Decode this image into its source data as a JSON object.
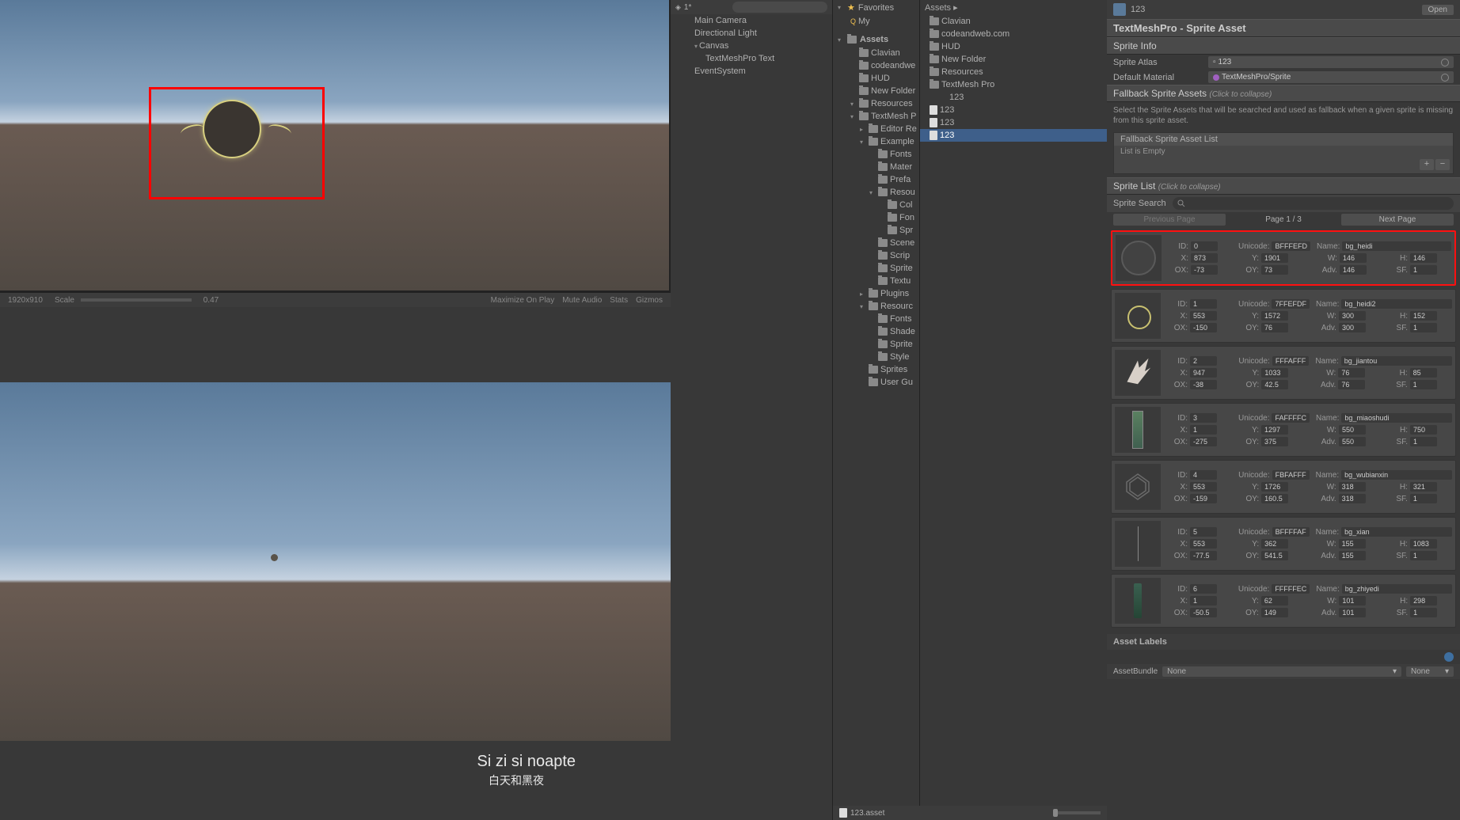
{
  "hierarchy": {
    "scene_name": "1*",
    "items": [
      {
        "label": "Main Camera",
        "l": 1
      },
      {
        "label": "Directional Light",
        "l": 1
      },
      {
        "label": "Canvas",
        "l": 1,
        "fold": "open"
      },
      {
        "label": "TextMeshPro Text",
        "l": 2
      },
      {
        "label": "EventSystem",
        "l": 1
      }
    ]
  },
  "game_controls": {
    "resolution": "1920x910",
    "scale_label": "Scale",
    "scale_value": "0.47",
    "right": [
      "Maximize On Play",
      "Mute Audio",
      "Stats",
      "Gizmos"
    ]
  },
  "subtitles": {
    "line1": "Si zi si noapte",
    "line2": "白天和黑夜"
  },
  "project": {
    "favorites_label": "Favorites",
    "my_label": "My",
    "assets_label": "Assets",
    "tree": [
      {
        "label": "Clavian",
        "l": 1
      },
      {
        "label": "codeandwe",
        "l": 1,
        "cut": true
      },
      {
        "label": "HUD",
        "l": 1
      },
      {
        "label": "New Folder",
        "l": 1,
        "cut": true
      },
      {
        "label": "Resources",
        "l": 1,
        "fold": "open"
      },
      {
        "label": "TextMesh P",
        "l": 1,
        "fold": "open",
        "cut": true
      },
      {
        "label": "Editor Re",
        "l": 2,
        "fold": "closed",
        "cut": true
      },
      {
        "label": "Example",
        "l": 2,
        "fold": "open",
        "cut": true
      },
      {
        "label": "Fonts",
        "l": 3
      },
      {
        "label": "Mater",
        "l": 3,
        "cut": true
      },
      {
        "label": "Prefa",
        "l": 3,
        "cut": true
      },
      {
        "label": "Resou",
        "l": 3,
        "fold": "open",
        "cut": true
      },
      {
        "label": "Col",
        "l": 4,
        "cut": true
      },
      {
        "label": "Fon",
        "l": 4,
        "cut": true
      },
      {
        "label": "Spr",
        "l": 4,
        "cut": true
      },
      {
        "label": "Scene",
        "l": 3,
        "cut": true
      },
      {
        "label": "Scrip",
        "l": 3,
        "cut": true
      },
      {
        "label": "Sprite",
        "l": 3,
        "cut": true
      },
      {
        "label": "Textu",
        "l": 3,
        "cut": true
      },
      {
        "label": "Plugins",
        "l": 2,
        "fold": "closed"
      },
      {
        "label": "Resourc",
        "l": 2,
        "fold": "open",
        "cut": true
      },
      {
        "label": "Fonts",
        "l": 3
      },
      {
        "label": "Shade",
        "l": 3,
        "cut": true
      },
      {
        "label": "Sprite",
        "l": 3,
        "cut": true
      },
      {
        "label": "Style",
        "l": 3,
        "cut": true
      },
      {
        "label": "Sprites",
        "l": 2
      },
      {
        "label": "User Gu",
        "l": 2,
        "cut": true
      }
    ],
    "breadcrumb": "Assets ▸",
    "right_items": [
      {
        "label": "Clavian",
        "icon": "folder"
      },
      {
        "label": "codeandweb.com",
        "icon": "folder"
      },
      {
        "label": "HUD",
        "icon": "folder"
      },
      {
        "label": "New Folder",
        "icon": "folder"
      },
      {
        "label": "Resources",
        "icon": "folder"
      },
      {
        "label": "TextMesh Pro",
        "icon": "folder"
      },
      {
        "label": "123",
        "icon": "none",
        "indent": true
      },
      {
        "label": "123",
        "icon": "file"
      },
      {
        "label": "123",
        "icon": "file"
      },
      {
        "label": "123",
        "icon": "file",
        "selected": true
      }
    ],
    "footer_file": "123.asset"
  },
  "inspector": {
    "header_name": "123",
    "open_btn": "Open",
    "title": "TextMeshPro - Sprite Asset",
    "sections": {
      "sprite_info": "Sprite Info",
      "sprite_atlas_label": "Sprite Atlas",
      "sprite_atlas_value": "123",
      "default_material_label": "Default Material",
      "default_material_value": "TextMeshPro/Sprite",
      "fallback_title": "Fallback Sprite Assets",
      "collapse": "(Click to collapse)",
      "fallback_desc": "Select the Sprite Assets that will be searched and used as fallback when a given sprite is missing from this sprite asset.",
      "fallback_list_title": "Fallback Sprite Asset List",
      "fallback_empty": "List is Empty",
      "sprite_list_title": "Sprite List",
      "sprite_search_label": "Sprite Search",
      "prev_page": "Previous Page",
      "page_info": "Page 1 / 3",
      "next_page": "Next Page"
    },
    "sprites": [
      {
        "id": "0",
        "unicode": "BFFFEFD",
        "name": "bg_heidi",
        "x": "873",
        "y": "1901",
        "w": "146",
        "h": "146",
        "ox": "-73",
        "oy": "73",
        "adv": "146",
        "sf": "1",
        "thumb": "circle",
        "hl": true
      },
      {
        "id": "1",
        "unicode": "7FFEFDF",
        "name": "bg_heidi2",
        "x": "553",
        "y": "1572",
        "w": "300",
        "h": "152",
        "ox": "-150",
        "oy": "76",
        "adv": "300",
        "sf": "1",
        "thumb": "ring"
      },
      {
        "id": "2",
        "unicode": "FFFAFFF",
        "name": "bg_jiantou",
        "x": "947",
        "y": "1033",
        "w": "76",
        "h": "85",
        "ox": "-38",
        "oy": "42.5",
        "adv": "76",
        "sf": "1",
        "thumb": "arrow"
      },
      {
        "id": "3",
        "unicode": "FAFFFFC",
        "name": "bg_miaoshudi",
        "x": "1",
        "y": "1297",
        "w": "550",
        "h": "750",
        "ox": "-275",
        "oy": "375",
        "adv": "550",
        "sf": "1",
        "thumb": "rect"
      },
      {
        "id": "4",
        "unicode": "FBFAFFF",
        "name": "bg_wubianxin",
        "x": "553",
        "y": "1726",
        "w": "318",
        "h": "321",
        "ox": "-159",
        "oy": "160.5",
        "adv": "318",
        "sf": "1",
        "thumb": "hex"
      },
      {
        "id": "5",
        "unicode": "BFFFFAF",
        "name": "bg_xian",
        "x": "553",
        "y": "362",
        "w": "155",
        "h": "1083",
        "ox": "-77.5",
        "oy": "541.5",
        "adv": "155",
        "sf": "1",
        "thumb": "line"
      },
      {
        "id": "6",
        "unicode": "FFFFFEC",
        "name": "bg_zhiyedi",
        "x": "1",
        "y": "62",
        "w": "101",
        "h": "298",
        "ox": "-50.5",
        "oy": "149",
        "adv": "101",
        "sf": "1",
        "thumb": "pillar"
      }
    ],
    "asset_labels": "Asset Labels",
    "bundle_label": "AssetBundle",
    "bundle_value": "None",
    "bundle_variant": "None"
  }
}
